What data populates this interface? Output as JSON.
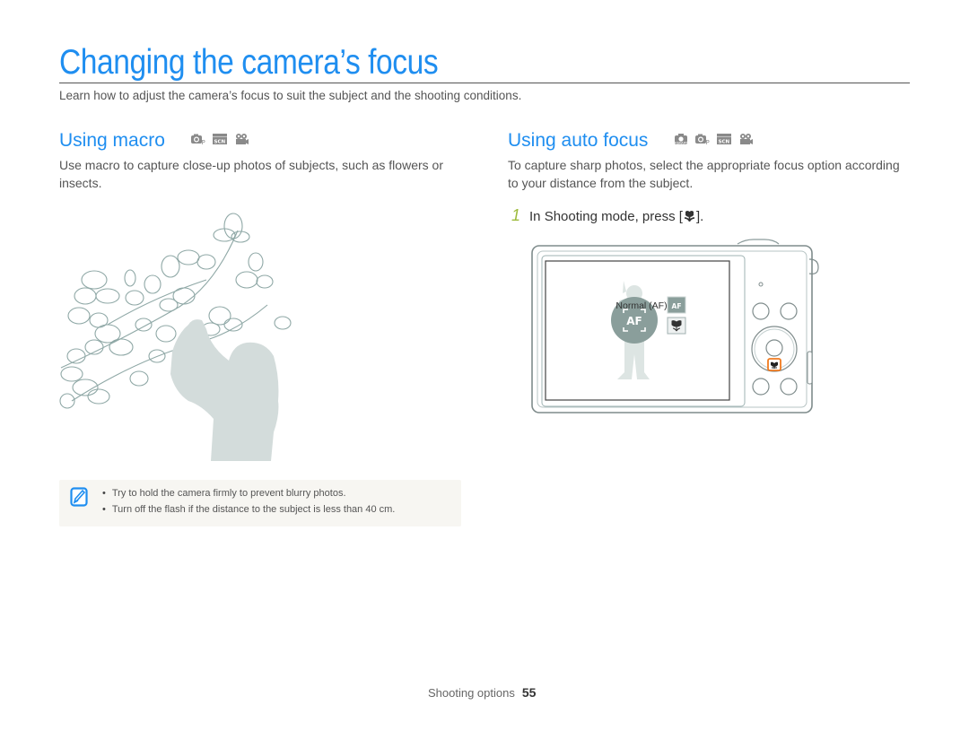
{
  "page": {
    "title": "Changing the camera’s focus",
    "intro": "Learn how to adjust the camera’s focus to suit the subject and the shooting conditions."
  },
  "macro": {
    "heading": "Using macro",
    "mode_icons": [
      "program-mode-icon",
      "scene-mode-icon",
      "movie-mode-icon"
    ],
    "description": "Use macro to capture close-up photos of subjects, such as flowers or insects.",
    "illustration": "woman-photographing-magnolia-flowers"
  },
  "auto_focus": {
    "heading": "Using auto focus",
    "mode_icons": [
      "smart-auto-mode-icon",
      "program-mode-icon",
      "scene-mode-icon",
      "movie-mode-icon"
    ],
    "description": "To capture sharp photos, select the appropriate focus option according to your distance from the subject.",
    "step": {
      "number": "1",
      "text_before": "In Shooting mode, press [",
      "key_icon": "macro-flower-icon",
      "text_after": "]."
    },
    "camera_screen": {
      "option_label": "Normal (AF)",
      "selected_option": "AF",
      "options": [
        "normal-af-icon",
        "macro-flower-icon"
      ]
    }
  },
  "note": {
    "icon": "note-pencil-icon",
    "items": [
      "Try to hold the camera firmly to prevent blurry photos.",
      "Turn off the flash if the distance to the subject is less than 40 cm."
    ]
  },
  "footer": {
    "section": "Shooting options",
    "page_number": "55"
  },
  "colors": {
    "accent": "#1f8ef0",
    "step_number": "#9dbb3c",
    "highlight": "#f07a1e",
    "note_bg": "#f7f6f2"
  }
}
